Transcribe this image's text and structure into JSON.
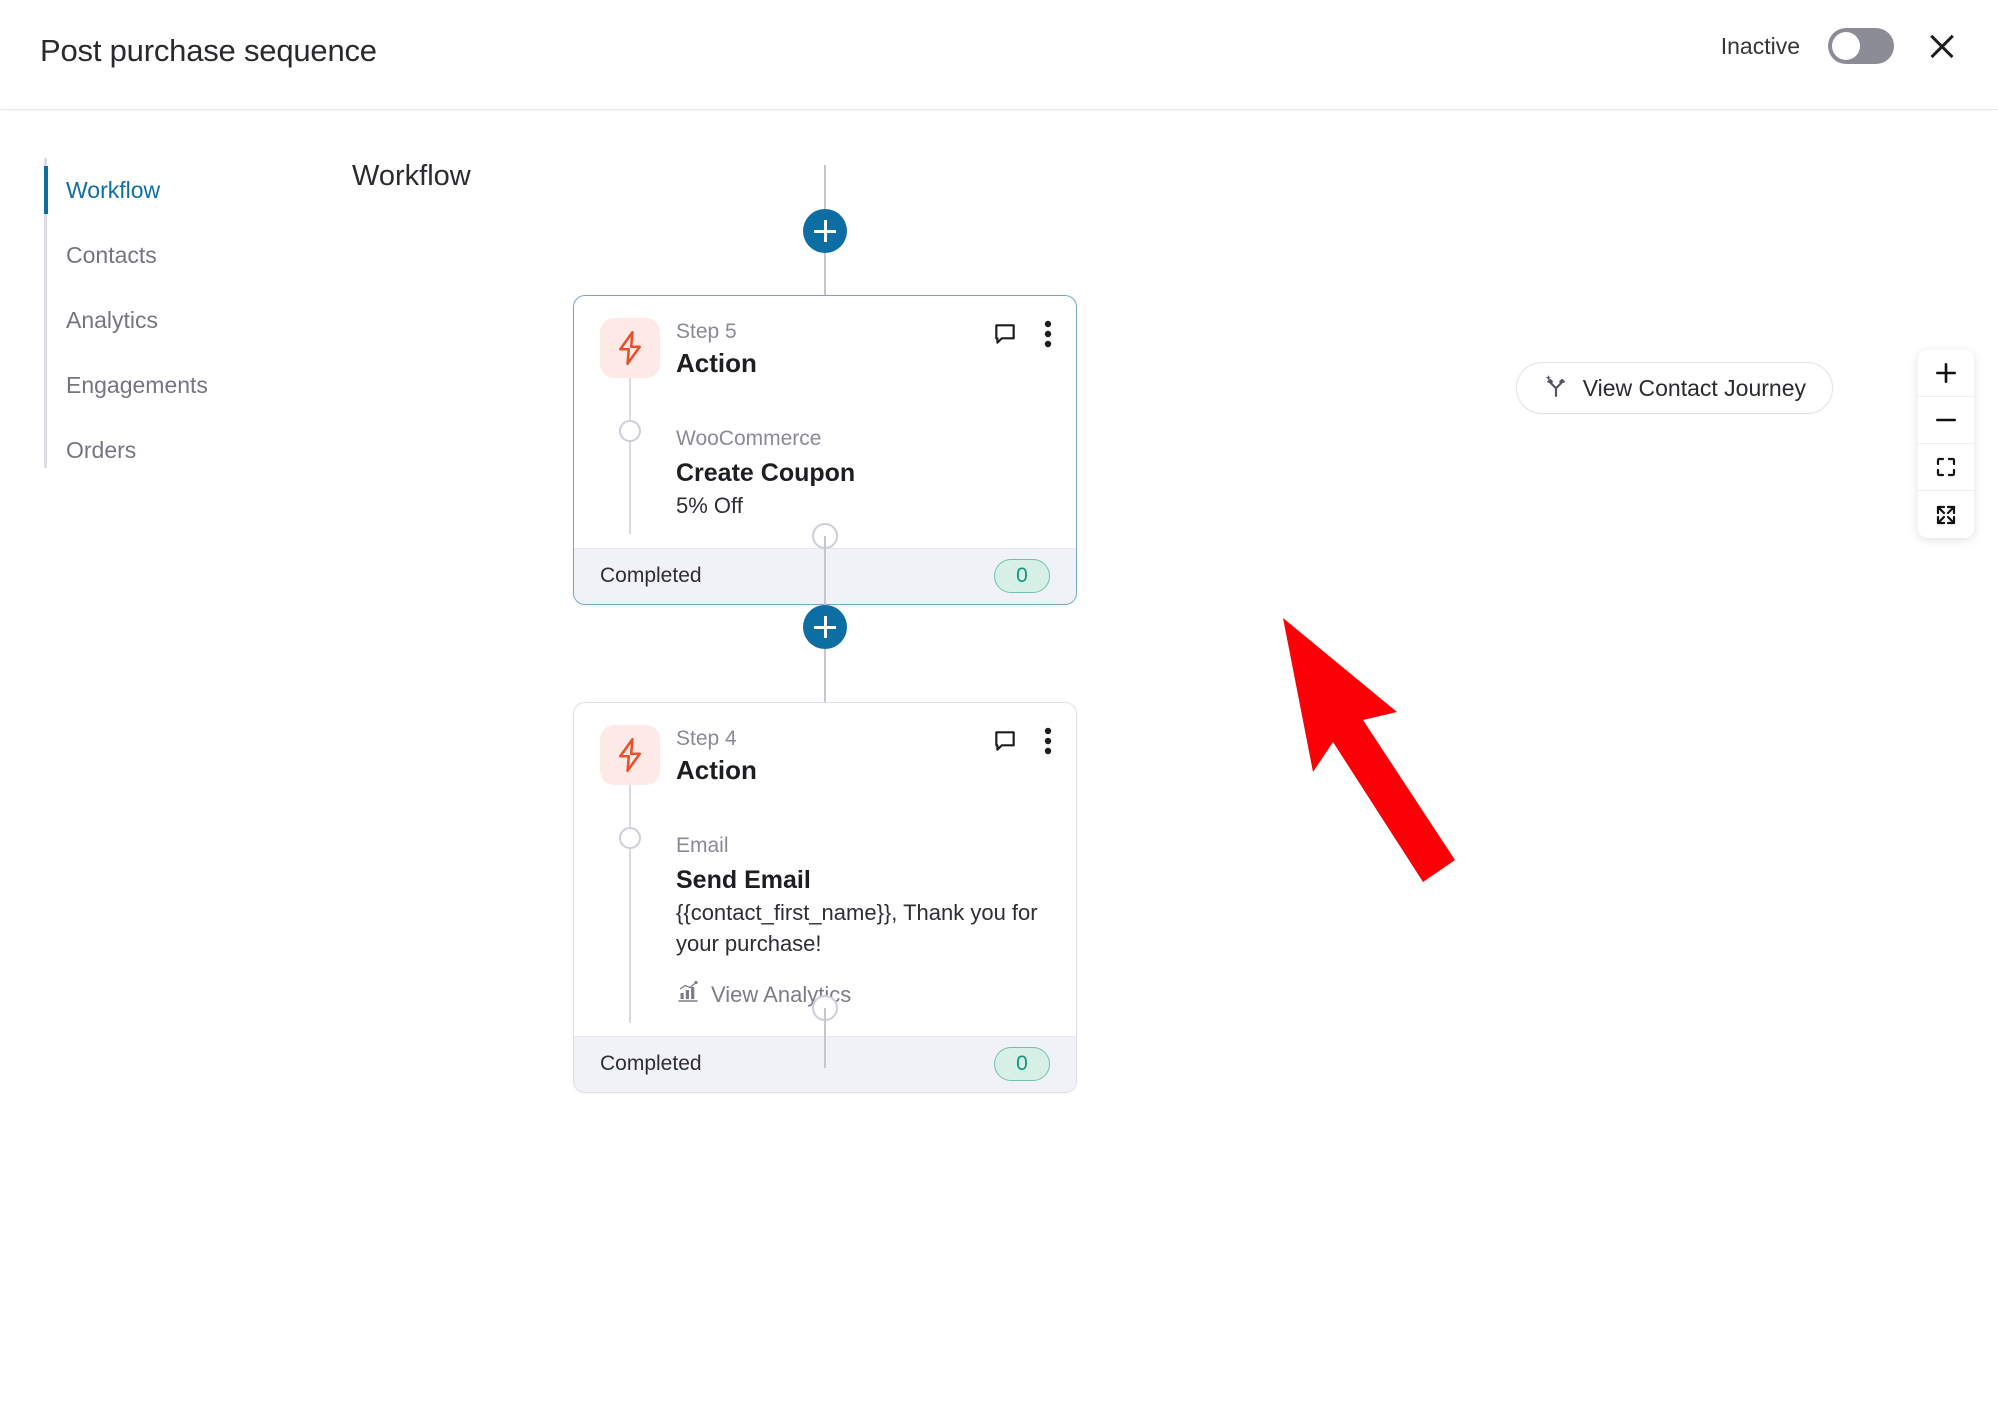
{
  "header": {
    "title": "Post purchase sequence",
    "status_label": "Inactive",
    "toggle_state": "off",
    "close_icon": "close-icon"
  },
  "sidebar": {
    "items": [
      {
        "label": "Workflow",
        "active": true
      },
      {
        "label": "Contacts",
        "active": false
      },
      {
        "label": "Analytics",
        "active": false
      },
      {
        "label": "Engagements",
        "active": false
      },
      {
        "label": "Orders",
        "active": false
      }
    ]
  },
  "canvas": {
    "title": "Workflow",
    "journey_button": {
      "label": "View Contact Journey",
      "icon": "journey-branch-icon"
    },
    "zoom_toolbar": [
      {
        "name": "zoom-in",
        "icon": "plus-icon"
      },
      {
        "name": "zoom-out",
        "icon": "minus-icon"
      },
      {
        "name": "fit-view",
        "icon": "fit-view-icon"
      },
      {
        "name": "expand",
        "icon": "expand-arrows-icon"
      }
    ],
    "add_step_icon": "plus-icon"
  },
  "steps": [
    {
      "step_label": "Step 5",
      "type": "Action",
      "icon": "lightning-bolt-icon",
      "app": "WooCommerce",
      "title": "Create Coupon",
      "subtitle": "5% Off",
      "status": "Completed",
      "count": "0",
      "selected": true,
      "has_analytics_link": false,
      "comment_icon": "comment-icon",
      "menu_icon": "more-vertical-icon"
    },
    {
      "step_label": "Step 4",
      "type": "Action",
      "icon": "lightning-bolt-icon",
      "app": "Email",
      "title": "Send Email",
      "subtitle": "{{contact_first_name}}, Thank you for your purchase!",
      "status": "Completed",
      "count": "0",
      "selected": false,
      "has_analytics_link": true,
      "analytics_label": "View Analytics",
      "analytics_icon": "bar-chart-icon",
      "comment_icon": "comment-icon",
      "menu_icon": "more-vertical-icon"
    }
  ],
  "annotation": {
    "type": "red-arrow",
    "points_to": "step-5-count-badge"
  },
  "colors": {
    "accent_blue": "#0d6ea3",
    "bolt_orange": "#e8502a",
    "bolt_bg": "#fdeae6",
    "badge_bg": "#d7f0e7",
    "badge_text": "#11967c",
    "footer_bg": "#f1f2f7",
    "annotation_red": "#fb0007"
  }
}
